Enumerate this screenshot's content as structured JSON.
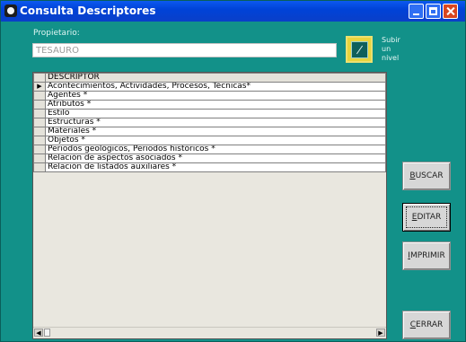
{
  "window": {
    "title": "Consulta Descriptores"
  },
  "owner": {
    "label": "Propietario:",
    "value": "TESAURO"
  },
  "up_level": {
    "note_line1": "Subir",
    "note_line2": "un",
    "note_line3": "nivel"
  },
  "grid": {
    "header": "DESCRIPTOR",
    "current_row_marker": "▶",
    "rows": [
      "Acontecimientos, Actividades, Procesos, Técnicas*",
      "Agentes *",
      "Atributos *",
      "Estilo",
      "Estructuras *",
      "Materiales *",
      "Objetos *",
      "Periodos geológicos, Periodos históricos *",
      "Relación de aspectos asociados *",
      "Relación de listados auxiliares *"
    ]
  },
  "buttons": {
    "buscar_prefix": "B",
    "buscar_rest": "USCAR",
    "editar_prefix": "E",
    "editar_rest": "DITAR",
    "imprimir_prefix": "I",
    "imprimir_rest": "MPRIMIR",
    "cerrar_prefix": "C",
    "cerrar_rest": "ERRAR"
  },
  "colors": {
    "background": "#129189",
    "title_bar": "#0a50e6",
    "highlight": "#e8d43d"
  }
}
